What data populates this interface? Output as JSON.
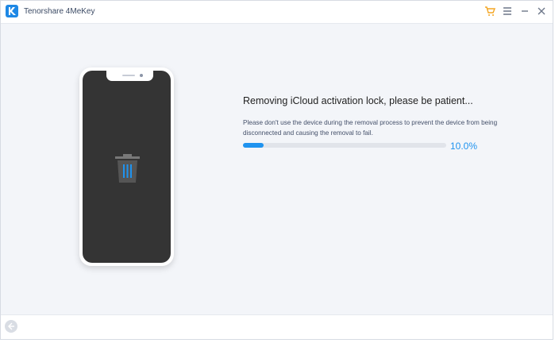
{
  "window": {
    "title": "Tenorshare 4MeKey"
  },
  "titlebar": {
    "icons": [
      "cart-icon",
      "menu-icon",
      "minimize-icon",
      "close-icon"
    ],
    "accent": "#f4a623"
  },
  "main": {
    "heading": "Removing iCloud activation lock, please be patient...",
    "description": "Please don't use the device during the removal process to prevent the device from being disconnected and causing the removal to fail.",
    "progress": {
      "value": 0.1,
      "label": "10.0%"
    }
  },
  "footer": {
    "back_icon": "back-arrow-icon"
  },
  "colors": {
    "progress": "#1f93ef",
    "phone_screen": "#343434",
    "logo": "#1e88e5"
  }
}
